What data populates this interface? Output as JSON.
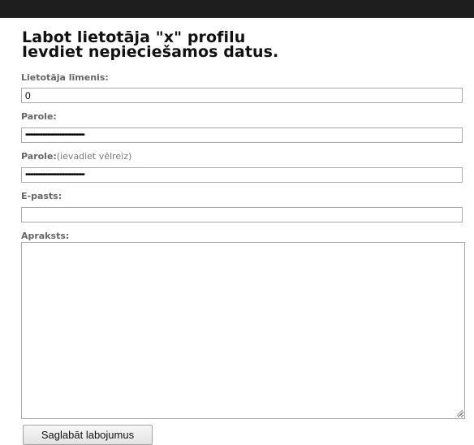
{
  "page": {
    "title_line1": "Labot lietotāja \"x\" profilu",
    "title_line2": "Ievdiet nepieciešamos datus."
  },
  "form": {
    "level": {
      "label": "Lietotāja līmenis:",
      "value": "0"
    },
    "password": {
      "label": "Parole:",
      "value": "••••••••••••••••••••••••••••••••••••••"
    },
    "password_repeat": {
      "label": "Parole:",
      "hint": "(ievadiet vēlreiz)",
      "value": "••••••••••••••••••••••••••••••••••••••"
    },
    "email": {
      "label": "E-pasts:",
      "value": ""
    },
    "description": {
      "label": "Apraksts:",
      "value": ""
    },
    "save_label": "Saglabāt labojumus"
  }
}
